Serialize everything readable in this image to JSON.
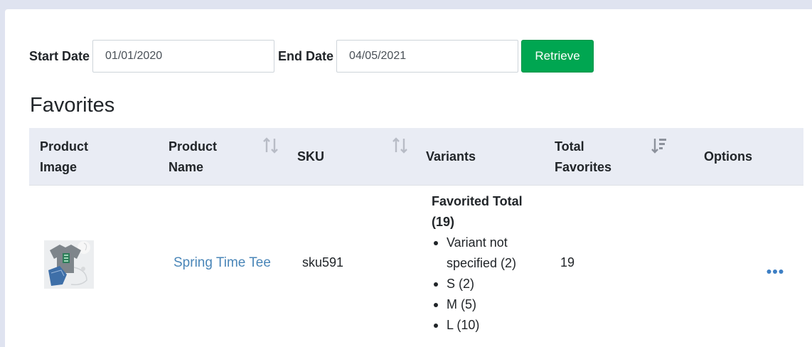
{
  "filters": {
    "start_label": "Start Date",
    "start_value": "01/01/2020",
    "end_label": "End Date",
    "end_value": "04/05/2021",
    "retrieve_label": "Retrieve"
  },
  "section_title": "Favorites",
  "table": {
    "columns": [
      {
        "label": "Product Image",
        "sortable": false
      },
      {
        "label": "Product Name",
        "sortable": true,
        "sort": "none"
      },
      {
        "label": "SKU",
        "sortable": true,
        "sort": "none"
      },
      {
        "label": "Variants",
        "sortable": false
      },
      {
        "label": "Total Favorites",
        "sortable": true,
        "sort": "descending"
      },
      {
        "label": "Options",
        "sortable": false
      }
    ],
    "rows": [
      {
        "product_image": "tshirt-flatlay-image",
        "product_name": "Spring Time Tee",
        "sku": "sku591",
        "variants_title": "Favorited Total (19)",
        "variants": [
          "Variant not specified (2)",
          "S (2)",
          "M (5)",
          "L (10)"
        ],
        "total_favorites": "19",
        "options_icon": "ellipsis-icon"
      }
    ]
  },
  "colors": {
    "accent_green": "#00a651",
    "link_blue": "#4a86b8",
    "header_bg": "#e9ecf4",
    "page_bg": "#dfe3f0"
  }
}
